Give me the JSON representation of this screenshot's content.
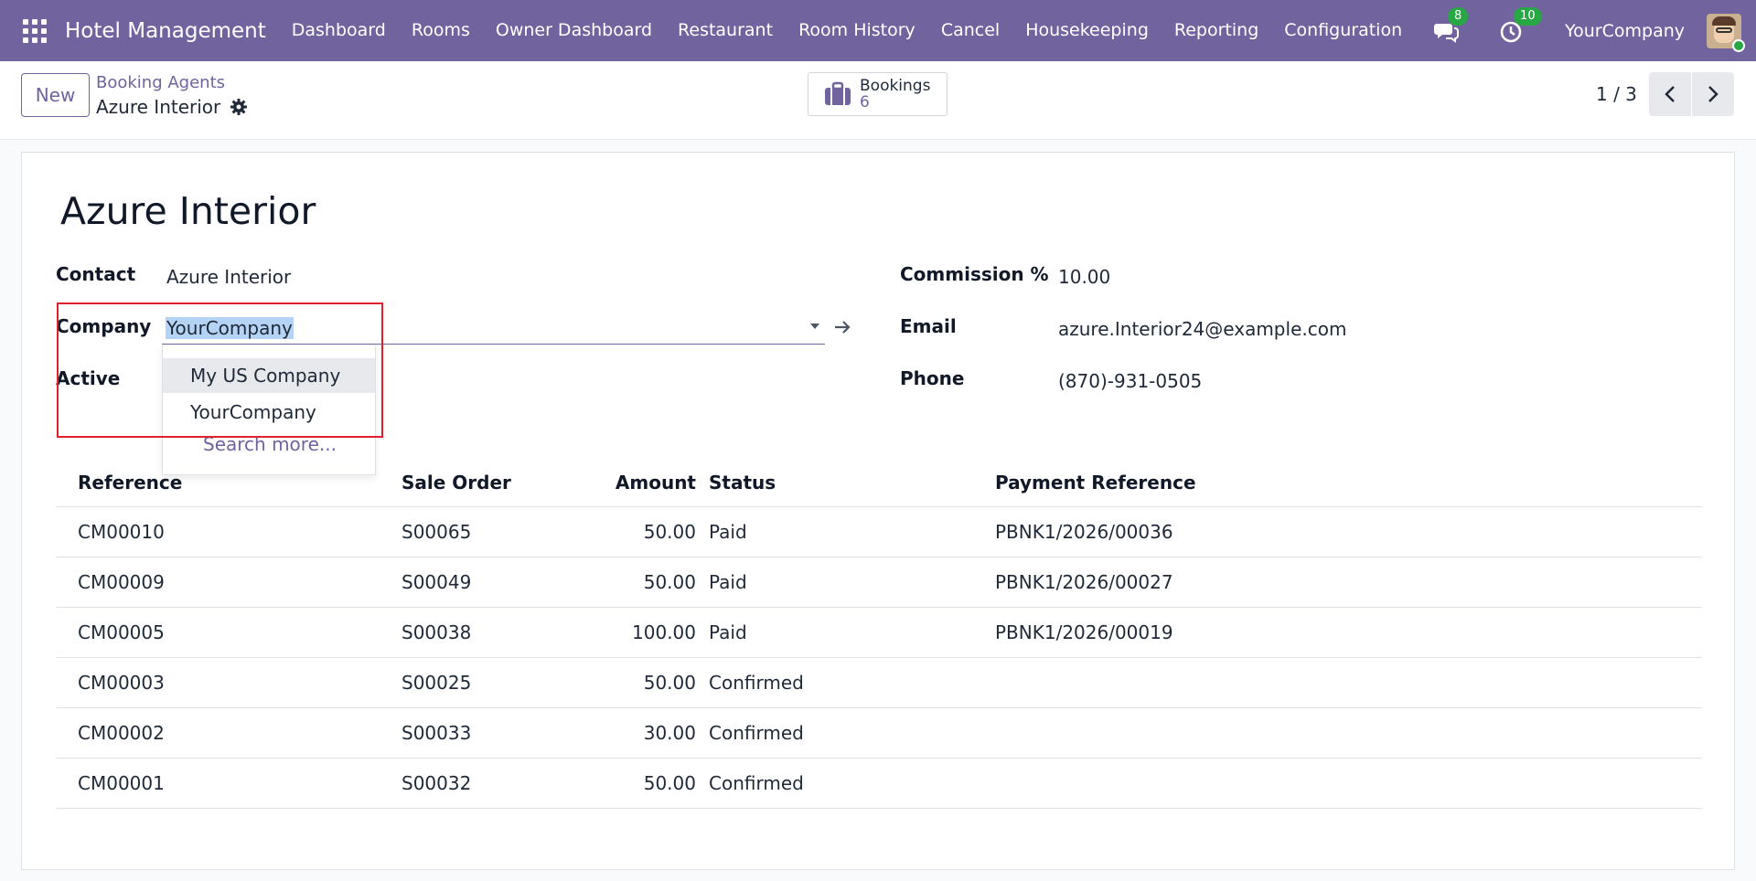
{
  "navbar": {
    "brand": "Hotel Management",
    "menu": [
      "Dashboard",
      "Rooms",
      "Owner Dashboard",
      "Restaurant",
      "Room History",
      "Cancel",
      "Housekeeping",
      "Reporting",
      "Configuration"
    ],
    "messages_count": "8",
    "activities_count": "10",
    "company": "YourCompany"
  },
  "control_panel": {
    "new_label": "New",
    "breadcrumb_parent": "Booking Agents",
    "breadcrumb_current": "Azure Interior",
    "smart_button": {
      "label": "Bookings",
      "value": "6"
    },
    "pager": "1 / 3"
  },
  "form": {
    "title": "Azure Interior",
    "contact": {
      "label": "Contact",
      "value": "Azure Interior"
    },
    "company": {
      "label": "Company",
      "value": "YourCompany"
    },
    "active": {
      "label": "Active"
    },
    "commission": {
      "label": "Commission %",
      "value": "10.00"
    },
    "email": {
      "label": "Email",
      "value": "azure.Interior24@example.com"
    },
    "phone": {
      "label": "Phone",
      "value": "(870)-931-0505"
    }
  },
  "dropdown": {
    "options": [
      "My US Company",
      "YourCompany"
    ],
    "search_more": "Search more..."
  },
  "table": {
    "headers": {
      "reference": "Reference",
      "sale_order": "Sale Order",
      "amount": "Amount",
      "status": "Status",
      "payment_reference": "Payment Reference"
    },
    "rows": [
      {
        "reference": "CM00010",
        "sale_order": "S00065",
        "amount": "50.00",
        "status": "Paid",
        "payment_reference": "PBNK1/2026/00036"
      },
      {
        "reference": "CM00009",
        "sale_order": "S00049",
        "amount": "50.00",
        "status": "Paid",
        "payment_reference": "PBNK1/2026/00027"
      },
      {
        "reference": "CM00005",
        "sale_order": "S00038",
        "amount": "100.00",
        "status": "Paid",
        "payment_reference": "PBNK1/2026/00019"
      },
      {
        "reference": "CM00003",
        "sale_order": "S00025",
        "amount": "50.00",
        "status": "Confirmed",
        "payment_reference": ""
      },
      {
        "reference": "CM00002",
        "sale_order": "S00033",
        "amount": "30.00",
        "status": "Confirmed",
        "payment_reference": ""
      },
      {
        "reference": "CM00001",
        "sale_order": "S00032",
        "amount": "50.00",
        "status": "Confirmed",
        "payment_reference": ""
      }
    ]
  },
  "colors": {
    "brand": "#71639e",
    "badge": "#28a745",
    "highlight": "#e0202b",
    "selection": "#b4d3f5"
  },
  "icons": [
    "apps-grid-icon",
    "chat-icon",
    "clock-icon",
    "gear-icon",
    "suitcase-icon",
    "chevron-left-icon",
    "chevron-right-icon",
    "caret-down-icon",
    "arrow-right-icon"
  ]
}
